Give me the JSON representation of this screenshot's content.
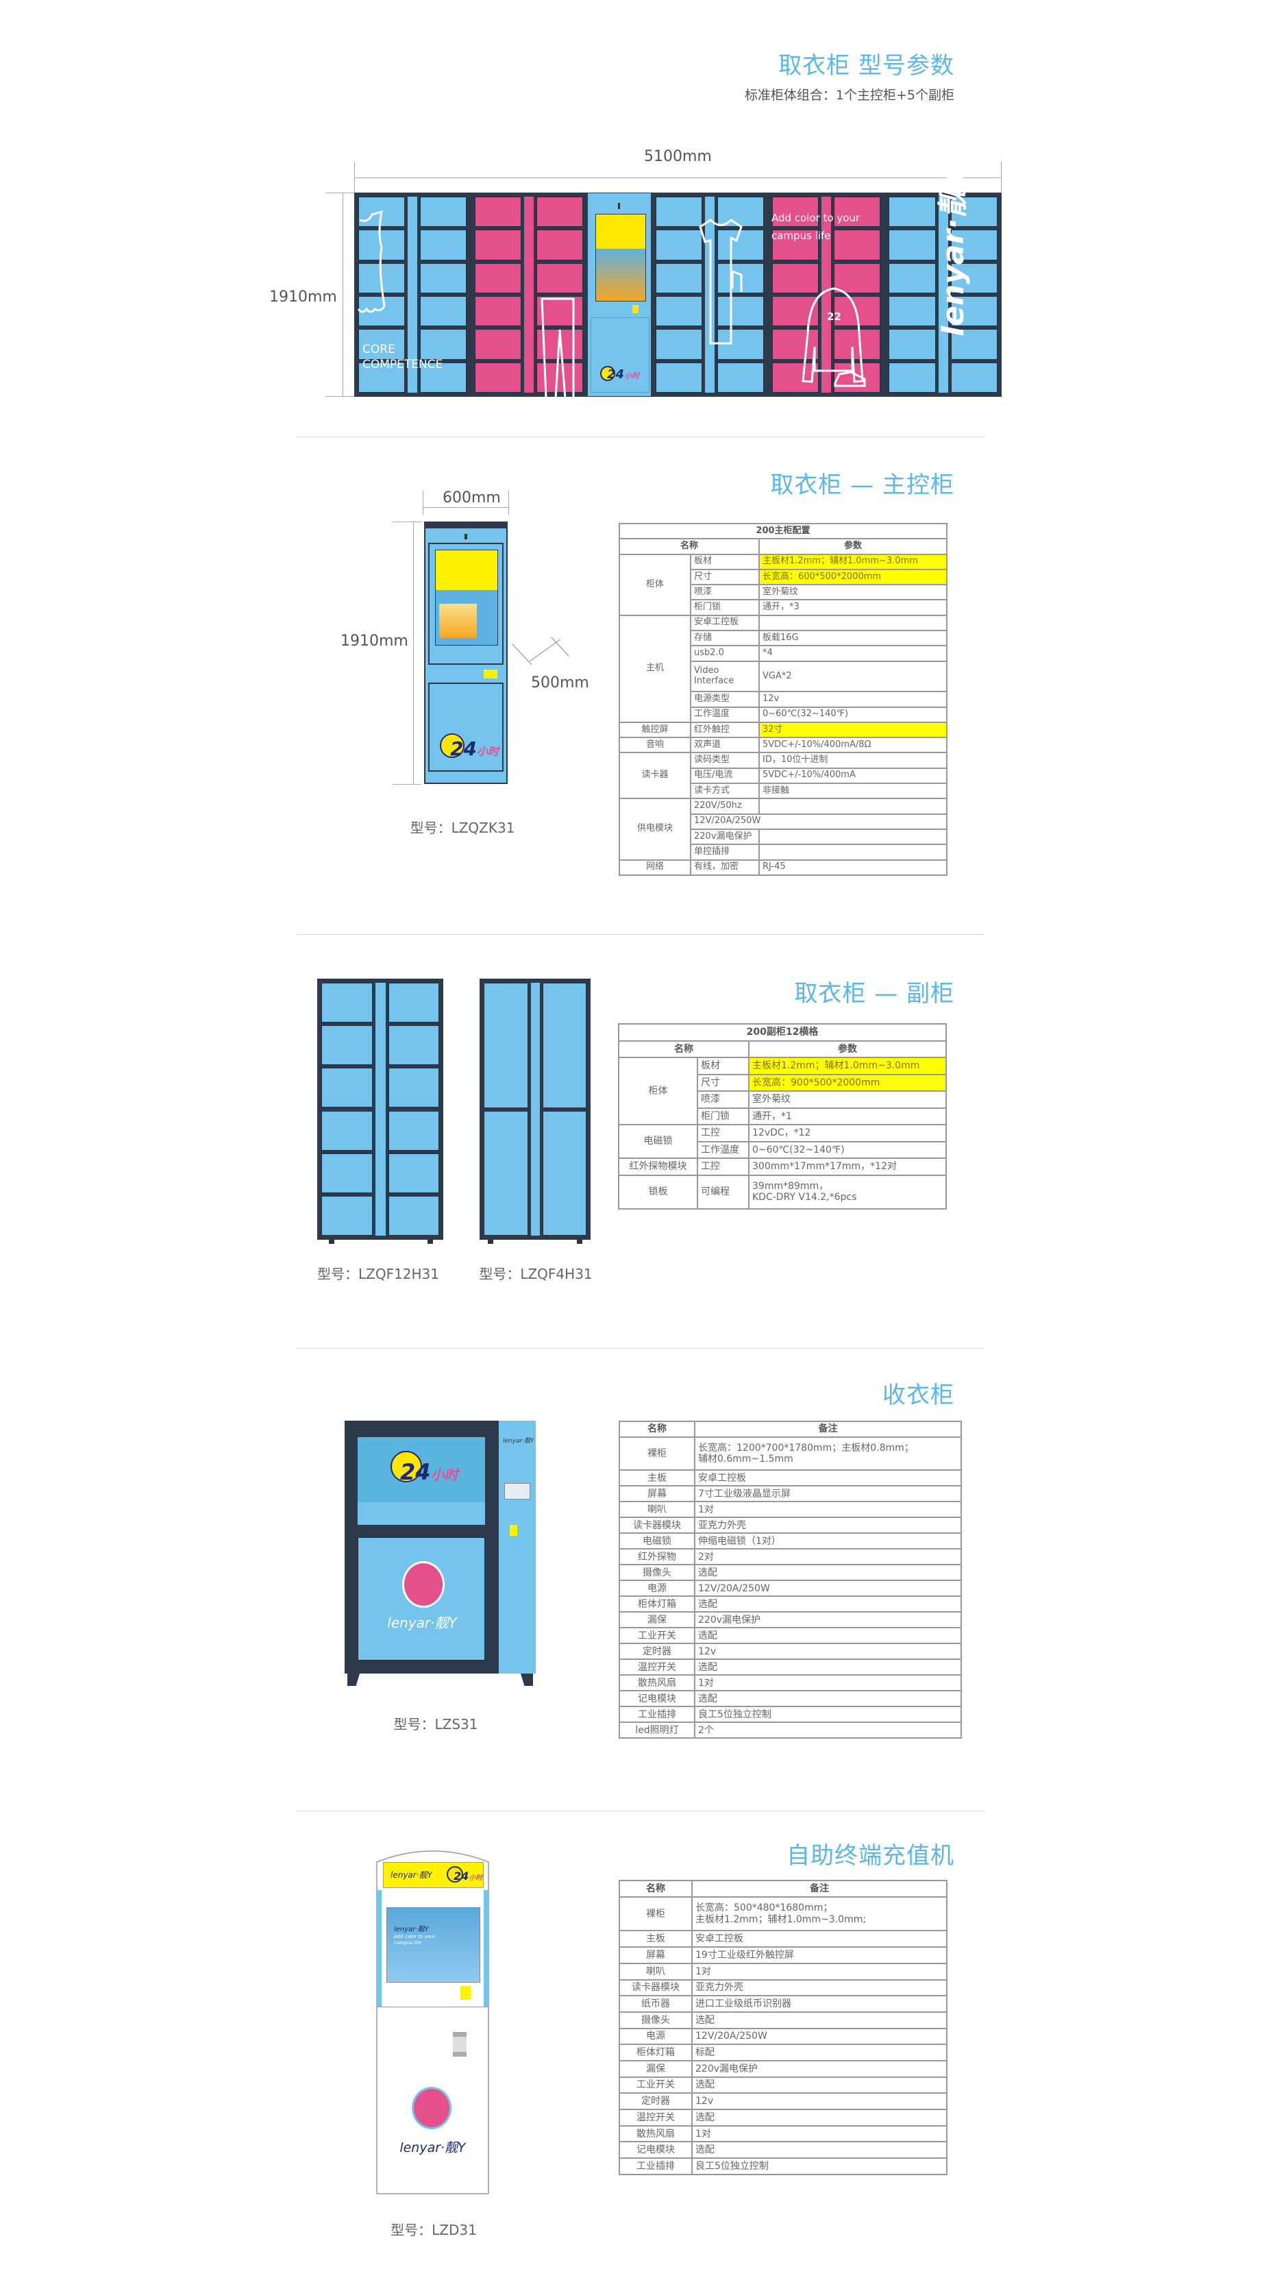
{
  "colors": {
    "accent": "#5ab7e8",
    "locker_blue": "#74c4ee",
    "locker_pink": "#e4508c",
    "frame": "#2c3a4c",
    "highlight": "#ffff00"
  },
  "header": {
    "title": "取衣柜 型号参数",
    "subtitle": "标准柜体组合：1个主控柜+5个副柜"
  },
  "overview": {
    "width_label": "5100mm",
    "height_label": "1910mm",
    "banner_text": {
      "core": "CORE",
      "competence": "COMPETENCE",
      "tagline_1": "Add color to your",
      "tagline_2": "campus life",
      "jersey_number": "22",
      "brand": "lenyar·靓Y"
    }
  },
  "main_cabinet": {
    "title": "取衣柜 — 主控柜",
    "width_label": "600mm",
    "height_label": "1910mm",
    "depth_label": "500mm",
    "model": "型号：LZQZK31",
    "logo": {
      "big": "24",
      "small": "小时"
    },
    "spec": {
      "title": "200主柜配置",
      "headers": [
        "名称",
        "参数"
      ],
      "groups": [
        {
          "name": "柜体",
          "rows": [
            {
              "item": "板材",
              "value": "主板材1.2mm；辅材1.0mm~3.0mm",
              "highlight": true
            },
            {
              "item": "尺寸",
              "value": "长宽高：600*500*2000mm",
              "highlight": true
            },
            {
              "item": "喷漆",
              "value": "室外菊纹"
            },
            {
              "item": "柜门锁",
              "value": "通开，*3"
            }
          ]
        },
        {
          "name": "主机",
          "rows": [
            {
              "item": "安卓工控板",
              "value": ""
            },
            {
              "item": "存储",
              "value": "板载16G"
            },
            {
              "item": "usb2.0",
              "value": "*4"
            },
            {
              "item": "Video\nInterface",
              "value": "VGA*2",
              "tall": true
            },
            {
              "item": "电源类型",
              "value": "12v"
            },
            {
              "item": "工作温度",
              "value": "0~60℃(32~140℉)"
            }
          ]
        },
        {
          "name": "触控屏",
          "rows": [
            {
              "item": "红外触控",
              "value": "32寸",
              "highlight": true
            }
          ]
        },
        {
          "name": "音响",
          "rows": [
            {
              "item": "双声道",
              "value": "5VDC+/-10%/400mA/8Ω"
            }
          ]
        },
        {
          "name": "读卡器",
          "rows": [
            {
              "item": "读码类型",
              "value": "ID，10位十进制"
            },
            {
              "item": "电压/电流",
              "value": "5VDC+/-10%/400mA"
            },
            {
              "item": "读卡方式",
              "value": "非接触"
            }
          ]
        },
        {
          "name": "供电模块",
          "rows": [
            {
              "item": "220V/50hz",
              "value": ""
            },
            {
              "item": "12V/20A/250W",
              "span": true
            },
            {
              "item": "220v漏电保护",
              "value": ""
            },
            {
              "item": "单控插排",
              "value": ""
            }
          ]
        },
        {
          "name": "网络",
          "rows": [
            {
              "item": "有线，加密",
              "value": "RJ-45"
            }
          ]
        }
      ]
    }
  },
  "sub_cabinet": {
    "title": "取衣柜 — 副柜",
    "models": [
      "型号：LZQF12H31",
      "型号：LZQF4H31"
    ],
    "spec": {
      "title": "200副柜12横格",
      "headers": [
        "名称",
        "参数"
      ],
      "groups": [
        {
          "name": "柜体",
          "rows": [
            {
              "item": "板材",
              "value": "主板材1.2mm；辅材1.0mm~3.0mm",
              "highlight": true
            },
            {
              "item": "尺寸",
              "value": "长宽高：900*500*2000mm",
              "highlight": true
            },
            {
              "item": "喷漆",
              "value": "室外菊纹"
            },
            {
              "item": "柜门锁",
              "value": "通开，*1"
            }
          ]
        },
        {
          "name": "电磁锁",
          "rows": [
            {
              "item": "工控",
              "value": "12vDC，*12"
            },
            {
              "item": "工作温度",
              "value": "0~60℃(32~140℉)"
            }
          ]
        },
        {
          "name": "红外探物模块",
          "rows": [
            {
              "item": "工控",
              "value": "300mm*17mm*17mm，*12对"
            }
          ]
        },
        {
          "name": "锁板",
          "rows": [
            {
              "item": "可编程",
              "value": "39mm*89mm，\nKDC-DRY V14.2,*6pcs",
              "tall": true
            }
          ]
        }
      ]
    }
  },
  "collect_cabinet": {
    "title": "收衣柜",
    "model": "型号：LZS31",
    "logo": {
      "big": "24",
      "small": "小时",
      "brand": "lenyar·靓Y"
    },
    "spec": {
      "headers": [
        "名称",
        "备注"
      ],
      "rows": [
        {
          "name": "裸柜",
          "value": "长宽高：1200*700*1780mm；主板材0.8mm；\n辅材0.6mm~1.5mm",
          "tall": true
        },
        {
          "name": "主板",
          "value": "安卓工控板"
        },
        {
          "name": "屏幕",
          "value": "7寸工业级液晶显示屏"
        },
        {
          "name": "喇叭",
          "value": "1对"
        },
        {
          "name": "读卡器模块",
          "value": "亚克力外壳"
        },
        {
          "name": "电磁锁",
          "value": "伸缩电磁锁（1对）"
        },
        {
          "name": "红外探物",
          "value": "2对"
        },
        {
          "name": "摄像头",
          "value": "选配"
        },
        {
          "name": "电源",
          "value": "12V/20A/250W"
        },
        {
          "name": "柜体灯箱",
          "value": "选配"
        },
        {
          "name": "漏保",
          "value": "220v漏电保护"
        },
        {
          "name": "工业开关",
          "value": "选配"
        },
        {
          "name": "定时器",
          "value": "12v"
        },
        {
          "name": "温控开关",
          "value": "选配"
        },
        {
          "name": "散热风扇",
          "value": "1对"
        },
        {
          "name": "记电模块",
          "value": "选配"
        },
        {
          "name": "工业插排",
          "value": "良工5位独立控制"
        },
        {
          "name": "led照明灯",
          "value": "2个"
        }
      ]
    }
  },
  "kiosk": {
    "title": "自助终端充值机",
    "model": "型号：LZD31",
    "logo": {
      "brand": "lenyar·靓Y",
      "big": "24",
      "small": "小时",
      "screen_line_1": "Add color to your",
      "screen_line_2": "campus life"
    },
    "spec": {
      "headers": [
        "名称",
        "备注"
      ],
      "rows": [
        {
          "name": "裸柜",
          "value": "长宽高：500*480*1680mm；\n主板材1.2mm；辅材1.0mm~3.0mm;",
          "tall": true
        },
        {
          "name": "主板",
          "value": "安卓工控板"
        },
        {
          "name": "屏幕",
          "value": "19寸工业级红外触控屏"
        },
        {
          "name": "喇叭",
          "value": "1对"
        },
        {
          "name": "读卡器模块",
          "value": "亚克力外壳"
        },
        {
          "name": "纸币器",
          "value": "进口工业级纸币识别器"
        },
        {
          "name": "摄像头",
          "value": "选配"
        },
        {
          "name": "电源",
          "value": "12V/20A/250W"
        },
        {
          "name": "柜体灯箱",
          "value": "标配"
        },
        {
          "name": "漏保",
          "value": "220v漏电保护"
        },
        {
          "name": "工业开关",
          "value": "选配"
        },
        {
          "name": "定时器",
          "value": "12v"
        },
        {
          "name": "温控开关",
          "value": "选配"
        },
        {
          "name": "散热风扇",
          "value": "1对"
        },
        {
          "name": "记电模块",
          "value": "选配"
        },
        {
          "name": "工业插排",
          "value": "良工5位独立控制"
        }
      ]
    }
  }
}
